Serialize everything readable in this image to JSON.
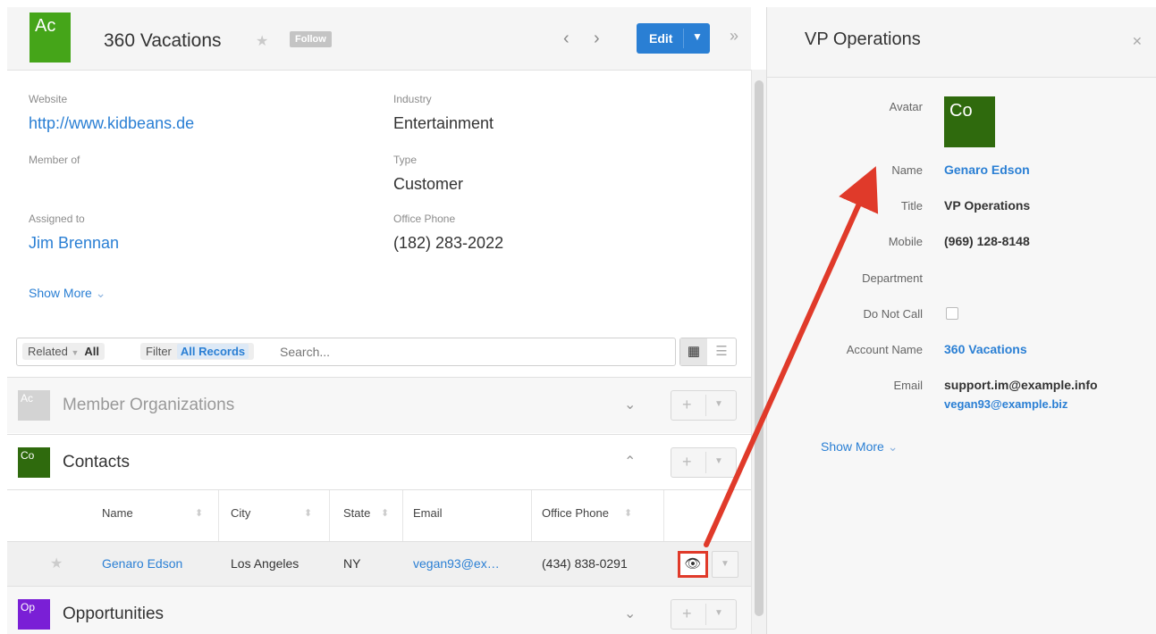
{
  "record": {
    "avatar_text": "Ac",
    "title": "360 Vacations",
    "follow_label": "Follow",
    "edit_label": "Edit",
    "fields": {
      "website_label": "Website",
      "website_value": "http://www.kidbeans.de",
      "industry_label": "Industry",
      "industry_value": "Entertainment",
      "member_of_label": "Member of",
      "type_label": "Type",
      "type_value": "Customer",
      "assigned_label": "Assigned to",
      "assigned_value": "Jim Brennan",
      "phone_label": "Office Phone",
      "phone_value": "(182) 283-2022"
    },
    "show_more": "Show More"
  },
  "toolbar": {
    "related_label": "Related",
    "related_value": "All",
    "filter_label": "Filter",
    "filter_value": "All Records",
    "search_placeholder": "Search..."
  },
  "subpanels": [
    {
      "avatar": "Ac",
      "title": "Member Organizations",
      "color": "#d3d3d3"
    },
    {
      "avatar": "Co",
      "title": "Contacts",
      "color": "#2f6a0d"
    },
    {
      "avatar": "Op",
      "title": "Opportunities",
      "color": "#7a1fd6"
    }
  ],
  "contacts_table": {
    "columns": [
      "Name",
      "City",
      "State",
      "Email",
      "Office Phone"
    ],
    "row": {
      "name": "Genaro Edson",
      "city": "Los Angeles",
      "state": "NY",
      "email": "vegan93@ex…",
      "phone": "(434) 838-0291"
    }
  },
  "preview": {
    "title": "VP Operations",
    "labels": {
      "avatar": "Avatar",
      "name": "Name",
      "title": "Title",
      "mobile": "Mobile",
      "department": "Department",
      "do_not_call": "Do Not Call",
      "account_name": "Account Name",
      "email": "Email"
    },
    "avatar_text": "Co",
    "name": "Genaro Edson",
    "mobile": "(969) 128-8148",
    "account_name": "360 Vacations",
    "email_1": "support.im@example.info",
    "email_2": "vegan93@example.biz",
    "show_more": "Show More"
  }
}
